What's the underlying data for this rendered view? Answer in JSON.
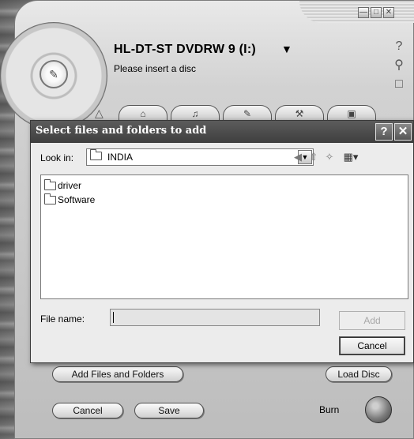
{
  "app": {
    "device_name": "HL-DT-ST DVDRW 9 (I:)",
    "status_text": "Please insert a disc",
    "add_files_label": "Add Files and Folders",
    "load_disc_label": "Load Disc",
    "cancel_label": "Cancel",
    "save_label": "Save",
    "burn_label": "Burn"
  },
  "dialog": {
    "title": "Select files and folders to add",
    "look_in_label": "Look in:",
    "look_in_value": "INDIA",
    "items": [
      {
        "name": "driver"
      },
      {
        "name": "Software"
      }
    ],
    "file_name_label": "File name:",
    "file_name_value": "",
    "add_label": "Add",
    "cancel_label": "Cancel"
  }
}
